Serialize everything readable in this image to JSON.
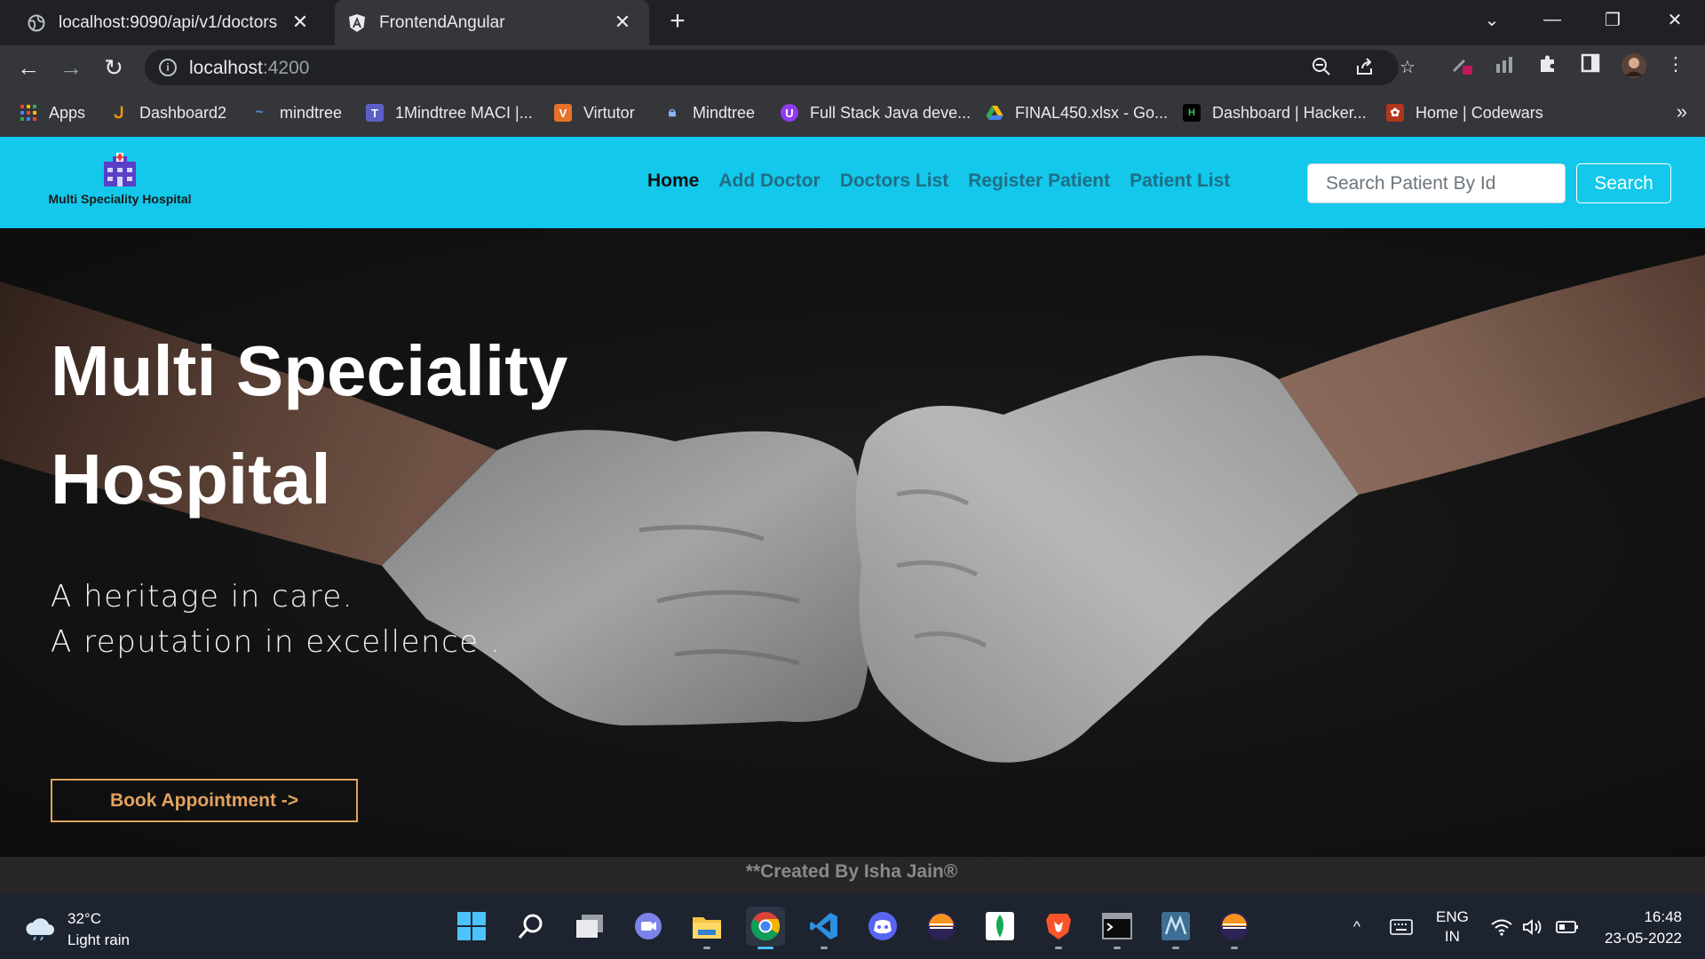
{
  "browser": {
    "tabs": [
      {
        "title": "localhost:9090/api/v1/doctors",
        "active": false
      },
      {
        "title": "FrontendAngular",
        "active": true
      }
    ],
    "url_host": "localhost",
    "url_port": ":4200",
    "bookmarks": [
      {
        "label": "Apps",
        "color": "#ea4335"
      },
      {
        "label": "Dashboard2",
        "color": "#f29900"
      },
      {
        "label": "mindtree",
        "color": "#4a90d9"
      },
      {
        "label": "1Mindtree MACI |...",
        "color": "#5b5fc7"
      },
      {
        "label": "Virtutor",
        "color": "#e8712b"
      },
      {
        "label": "Mindtree",
        "color": "#8ab4f8"
      },
      {
        "label": "Full Stack Java deve...",
        "color": "#8e3cf0"
      },
      {
        "label": "FINAL450.xlsx - Go...",
        "color": "#34a853"
      },
      {
        "label": "Dashboard | Hacker...",
        "color": "#000000"
      },
      {
        "label": "Home | Codewars",
        "color": "#b1361e"
      }
    ]
  },
  "app": {
    "brand": "Multi Speciality Hospital",
    "nav": [
      {
        "label": "Home",
        "active": true
      },
      {
        "label": "Add Doctor",
        "active": false
      },
      {
        "label": "Doctors List",
        "active": false
      },
      {
        "label": "Register Patient",
        "active": false
      },
      {
        "label": "Patient List",
        "active": false
      }
    ],
    "search_placeholder": "Search Patient By Id",
    "search_button": "Search",
    "hero": {
      "title_line1": "Multi Speciality",
      "title_line2": "Hospital",
      "tagline1": "A heritage in care.",
      "tagline2": "A reputation in excellence .",
      "cta": "Book Appointment ->"
    },
    "footer": "**Created By Isha Jain®"
  },
  "taskbar": {
    "temperature": "32°C",
    "weather": "Light rain",
    "lang1": "ENG",
    "lang2": "IN",
    "time": "16:48",
    "date": "23-05-2022"
  },
  "colors": {
    "navbar": "#13c8eb",
    "accent": "#e2a35f"
  }
}
